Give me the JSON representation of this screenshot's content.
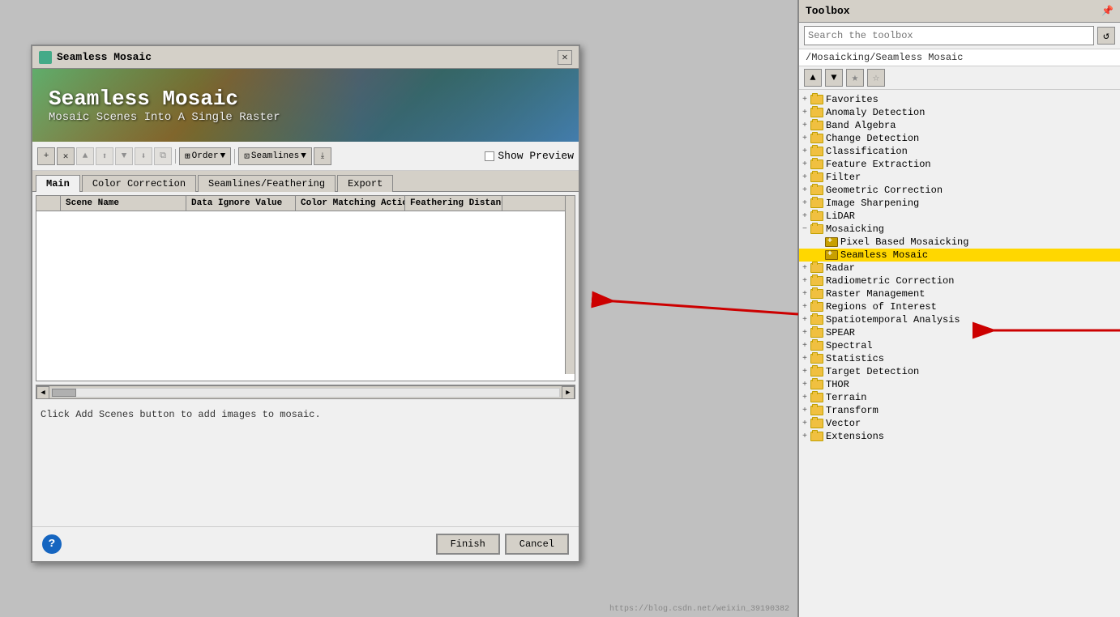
{
  "dialog": {
    "title": "Seamless Mosaic",
    "banner_title": "Seamless Mosaic",
    "banner_subtitle": "Mosaic Scenes Into A Single Raster",
    "tabs": [
      "Main",
      "Color Correction",
      "Seamlines/Feathering",
      "Export"
    ],
    "active_tab": "Main",
    "table": {
      "columns": [
        "Scene Name",
        "Data Ignore Value",
        "Color Matching Action",
        "Feathering Distance"
      ],
      "rows": []
    },
    "status_text": "Click Add Scenes button to add images to mosaic.",
    "toolbar": {
      "order_label": "Order",
      "seamlines_label": "Seamlines",
      "show_preview": "Show Preview"
    },
    "buttons": {
      "finish": "Finish",
      "cancel": "Cancel"
    },
    "breadcrumb": "/Mosaicking/Seamless Mosaic"
  },
  "toolbox": {
    "title": "Toolbox",
    "search_placeholder": "Search the toolbox",
    "breadcrumb": "/Mosaicking/Seamless Mosaic",
    "tree": [
      {
        "id": "favorites",
        "label": "Favorites",
        "level": 0,
        "type": "folder",
        "expanded": false
      },
      {
        "id": "anomaly",
        "label": "Anomaly Detection",
        "level": 0,
        "type": "folder",
        "expanded": false
      },
      {
        "id": "band",
        "label": "Band Algebra",
        "level": 0,
        "type": "folder",
        "expanded": false
      },
      {
        "id": "change",
        "label": "Change Detection",
        "level": 0,
        "type": "folder",
        "expanded": false
      },
      {
        "id": "classification",
        "label": "Classification",
        "level": 0,
        "type": "folder",
        "expanded": false
      },
      {
        "id": "feature",
        "label": "Feature Extraction",
        "level": 0,
        "type": "folder",
        "expanded": false
      },
      {
        "id": "filter",
        "label": "Filter",
        "level": 0,
        "type": "folder",
        "expanded": false
      },
      {
        "id": "geometric",
        "label": "Geometric Correction",
        "level": 0,
        "type": "folder",
        "expanded": false
      },
      {
        "id": "image_sharp",
        "label": "Image Sharpening",
        "level": 0,
        "type": "folder",
        "expanded": false
      },
      {
        "id": "lidar",
        "label": "LiDAR",
        "level": 0,
        "type": "folder",
        "expanded": false
      },
      {
        "id": "mosaicking",
        "label": "Mosaicking",
        "level": 0,
        "type": "folder",
        "expanded": true
      },
      {
        "id": "pixel_mosaic",
        "label": "Pixel Based Mosaicking",
        "level": 1,
        "type": "tool",
        "expanded": false
      },
      {
        "id": "seamless",
        "label": "Seamless Mosaic",
        "level": 1,
        "type": "tool",
        "expanded": false,
        "selected": true
      },
      {
        "id": "radar",
        "label": "Radar",
        "level": 0,
        "type": "folder",
        "expanded": false
      },
      {
        "id": "radiometric",
        "label": "Radiometric Correction",
        "level": 0,
        "type": "folder",
        "expanded": false
      },
      {
        "id": "raster_mgmt",
        "label": "Raster Management",
        "level": 0,
        "type": "folder",
        "expanded": false
      },
      {
        "id": "regions",
        "label": "Regions of Interest",
        "level": 0,
        "type": "folder",
        "expanded": false
      },
      {
        "id": "spatiotemporal",
        "label": "Spatiotemporal Analysis",
        "level": 0,
        "type": "folder",
        "expanded": false
      },
      {
        "id": "spear",
        "label": "SPEAR",
        "level": 0,
        "type": "folder",
        "expanded": false
      },
      {
        "id": "spectral",
        "label": "Spectral",
        "level": 0,
        "type": "folder",
        "expanded": false
      },
      {
        "id": "statistics",
        "label": "Statistics",
        "level": 0,
        "type": "folder",
        "expanded": false
      },
      {
        "id": "target",
        "label": "Target Detection",
        "level": 0,
        "type": "folder",
        "expanded": false
      },
      {
        "id": "thor",
        "label": "THOR",
        "level": 0,
        "type": "folder",
        "expanded": false
      },
      {
        "id": "terrain",
        "label": "Terrain",
        "level": 0,
        "type": "folder",
        "expanded": false
      },
      {
        "id": "transform",
        "label": "Transform",
        "level": 0,
        "type": "folder",
        "expanded": false
      },
      {
        "id": "vector",
        "label": "Vector",
        "level": 0,
        "type": "folder",
        "expanded": false
      },
      {
        "id": "extensions",
        "label": "Extensions",
        "level": 0,
        "type": "folder",
        "expanded": false
      }
    ]
  },
  "watermark": "https://blog.csdn.net/weixin_39190382"
}
